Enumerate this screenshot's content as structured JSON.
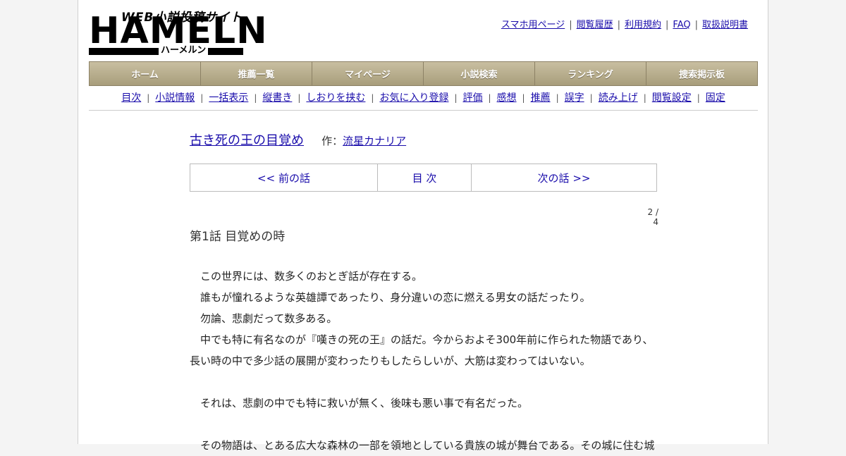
{
  "logo": {
    "tagline": "WEB小説投稿サイト",
    "wordmark": "HAMELN",
    "kana": "ハーメルン"
  },
  "top_links": [
    "スマホ用ページ",
    "閲覧履歴",
    "利用規約",
    "FAQ",
    "取扱説明書"
  ],
  "global_nav": [
    "ホーム",
    "推薦一覧",
    "マイページ",
    "小説検索",
    "ランキング",
    "捜索掲示板"
  ],
  "sub_nav": [
    "目次",
    "小説情報",
    "一括表示",
    "縦書き",
    "しおりを挟む",
    "お気に入り登録",
    "評価",
    "感想",
    "推薦",
    "誤字",
    "読み上げ",
    "閲覧設定",
    "固定"
  ],
  "novel": {
    "title": "古き死の王の目覚め",
    "author_label": "作：",
    "author": "流星カナリア"
  },
  "pager": {
    "prev": "<< 前の話",
    "toc": "目 次",
    "next": "次の話 >>"
  },
  "page_count": "2 / 4",
  "chapter_title": "第1話 目覚めの時",
  "body": [
    "　この世界には、数多くのおとぎ話が存在する。",
    "　誰もが憧れるような英雄譚であったり、身分違いの恋に燃える男女の話だったり。",
    "　勿論、悲劇だって数多ある。",
    "　中でも特に有名なのが『嘆きの死の王』の話だ。今からおよそ300年前に作られた物語であり、長い時の中で多少話の展開が変わったりもしたらしいが、大筋は変わってはいない。",
    "",
    "　それは、悲劇の中でも特に救いが無く、後味も悪い事で有名だった。",
    "",
    "　その物語は、とある広大な森林の一部を領地としている貴族の城が舞台である。その城に住む城"
  ]
}
